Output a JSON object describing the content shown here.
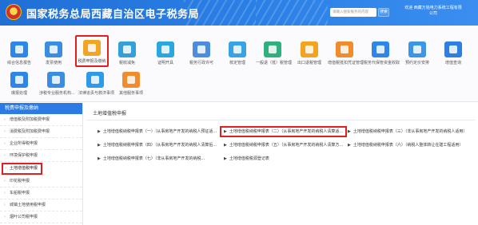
{
  "header": {
    "title": "国家税务总局西藏自治区电子税务局",
    "search_placeholder": "请输入搜索服务的内容",
    "search_button": "搜索",
    "user_line1": "欢迎 西藏万铭电力系统工程有限",
    "user_line2": "公司"
  },
  "icons": [
    {
      "label": "综合信息报告",
      "color": "#2e86e8"
    },
    {
      "label": "发票使用",
      "color": "#3a8de0"
    },
    {
      "label": "税费申报及缴纳",
      "color": "#f0a526"
    },
    {
      "label": "税收减免",
      "color": "#34a0d8"
    },
    {
      "label": "证明开具",
      "color": "#2aa6e0"
    },
    {
      "label": "税务行政许可",
      "color": "#4c8de0"
    },
    {
      "label": "核定管理",
      "color": "#37a2e6"
    },
    {
      "label": "一般退（抵）税管理",
      "color": "#2fb07e"
    },
    {
      "label": "出口退税管理",
      "color": "#f4a321"
    },
    {
      "label": "增值税抵扣凭证管理",
      "color": "#f08c2c"
    },
    {
      "label": "税务代保管资金收取",
      "color": "#2e86e8"
    },
    {
      "label": "预约定价安排",
      "color": "#3d95e6"
    },
    {
      "label": "增值查询",
      "color": "#2e7fe0"
    },
    {
      "label": "爆报处理",
      "color": "#2e86e8"
    },
    {
      "label": "涉税专业服务机构...",
      "color": "#3a8de0"
    },
    {
      "label": "法律追责与救济事项",
      "color": "#2f9be8"
    },
    {
      "label": "其他服务事项",
      "color": "#f08c2c"
    }
  ],
  "sidebar": {
    "heading": "税费申报及缴纳",
    "items": [
      "增值税及附加税费申报",
      "消费税及附加税费申报",
      "企业所得税申报",
      "环境保护税申报",
      "土地增值税申报",
      "印花税申报",
      "车船税申报",
      "城镇土地使用税申报",
      "烟叶公司税申报"
    ]
  },
  "main": {
    "title": "土地增值税申报",
    "links": [
      "土地增值税纳税申报表（一）（从事房地产开发的纳税人预征适...",
      "土地增值税纳税申报表（二）（从事房地产开发的纳税人清算适...",
      "土地增值税纳税申报表（三）（非从事房地产开发的纳税人适用）",
      "土地增值税纳税申报表（四）（从事房地产开发的纳税人清算后...",
      "土地增值税纳税申报表（五）（从事房地产开发的纳税人清算方...",
      "土地增值税纳税申报表（六）（纳税人整体转让在建工程适用）",
      "土地增值税纳税申报表（七）（非从事房地产开发的纳税...",
      "土地增值税税源登记表"
    ]
  }
}
